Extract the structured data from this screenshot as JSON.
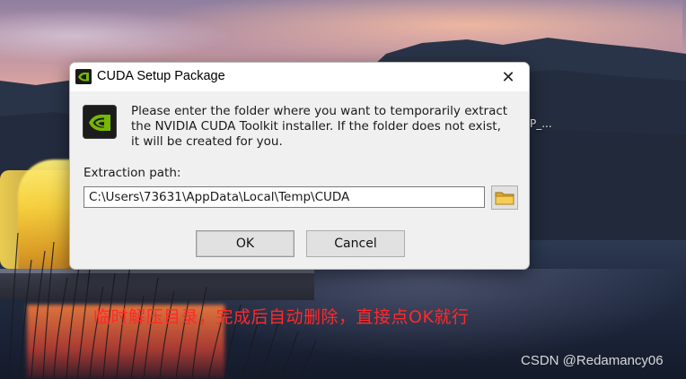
{
  "desktop": {
    "partial_icon_label": "P_...",
    "annotation": "临时解压目录，完成后自动删除，直接点OK就行",
    "watermark": "CSDN @Redamancy06"
  },
  "dialog": {
    "title": "CUDA Setup Package",
    "close_glyph": "✕",
    "message": "Please enter the folder where you want to temporarily extract\nthe NVIDIA CUDA Toolkit installer. If the folder does not exist,\nit will be created for you.",
    "path_label": "Extraction path:",
    "path_value": "C:\\Users\\73631\\AppData\\Local\\Temp\\CUDA",
    "ok_label": "OK",
    "cancel_label": "Cancel",
    "icons": {
      "title_icon": "nvidia-logo-icon",
      "main_icon": "nvidia-logo-icon",
      "browse_icon": "folder-icon"
    }
  },
  "colors": {
    "annotation": "#ff2a2a",
    "nvidia_green": "#76b900",
    "dialog_bg": "#f0f0f0"
  }
}
